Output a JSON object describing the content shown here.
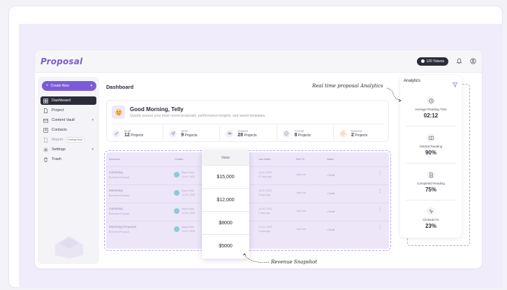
{
  "header": {
    "logo": "Proposal",
    "tokens_label": "120 Tokens"
  },
  "sidebar": {
    "create_label": "Create New",
    "items": [
      {
        "label": "Dashboard"
      },
      {
        "label": "Project"
      },
      {
        "label": "Content Vault"
      },
      {
        "label": "Contacts"
      },
      {
        "label": "Report",
        "badge": "Coming Soon"
      },
      {
        "label": "Settings"
      },
      {
        "label": "Trash"
      }
    ]
  },
  "main": {
    "title": "Dashboard",
    "greeting": "Good Morning, Telly",
    "greeting_sub": "Quickly access your most recent proposals, performance insights, and saved templates.",
    "stats": [
      {
        "label": "Draft",
        "count": "12",
        "unit": "Projects"
      },
      {
        "label": "Sent",
        "count": "9",
        "unit": "Projects"
      },
      {
        "label": "Viewed",
        "count": "28",
        "unit": "Projects"
      },
      {
        "label": "Accept",
        "count": "8",
        "unit": "Projects"
      },
      {
        "label": "Expired",
        "count": "2",
        "unit": "Projects"
      }
    ]
  },
  "table": {
    "headers": [
      "Document",
      "Created",
      "Last Edited",
      "Sent To",
      "Status"
    ],
    "rows": [
      {
        "name": "marketing",
        "sub": "Business Proposal",
        "owner": "Maya Shah",
        "owner_date": "Jul 16, 2025",
        "edited": "Jul 20, 2025",
        "edited_sub": "12 days ago",
        "sent": "Jack Lee",
        "status": "Draft"
      },
      {
        "name": "Marketing",
        "sub": "Business Proposal",
        "owner": "Maya Shah",
        "owner_date": "Jul 16, 2025",
        "edited": "Jul 20, 2025",
        "edited_sub": "8 days ago",
        "sent": "Jack Lee",
        "status": "Draft"
      },
      {
        "name": "marketing",
        "sub": "Business Proposal",
        "owner": "Maya Shah",
        "owner_date": "Jul 16, 2025",
        "edited": "Jul 20, 2025",
        "edited_sub": "5 days ago",
        "sent": "Jack Lee",
        "status": "Draft"
      },
      {
        "name": "Marketing Proposal",
        "sub": "Business Proposal",
        "owner": "Maya Shah",
        "owner_date": "Jul 16, 2025",
        "edited": "Jul 20, 2025",
        "edited_sub": "3 days ago",
        "sent": "Jack Lee",
        "status": "Draft"
      }
    ]
  },
  "value_column": {
    "header": "Value",
    "values": [
      "$15,000",
      "$12,000",
      "$8000",
      "$5000"
    ]
  },
  "analytics": {
    "title": "Analytics",
    "items": [
      {
        "label": "Average Reading Time",
        "value": "02:12"
      },
      {
        "label": "Started Reading",
        "value": "90%"
      },
      {
        "label": "Completed Reading",
        "value": "75%"
      },
      {
        "label": "ClickedCTA",
        "value": "23%"
      }
    ]
  },
  "annotations": {
    "analytics": "Real time proposal Analytics",
    "revenue": "Revenue Snapshot"
  },
  "colors": {
    "accent": "#7b5cd6",
    "dark": "#2b2b3a",
    "lavender": "#f1ecfb"
  }
}
